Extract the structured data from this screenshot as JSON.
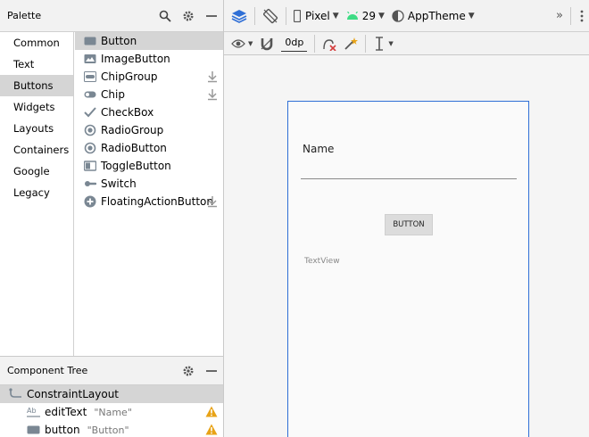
{
  "palette": {
    "title": "Palette",
    "categories": [
      "Common",
      "Text",
      "Buttons",
      "Widgets",
      "Layouts",
      "Containers",
      "Google",
      "Legacy"
    ],
    "selected_category": "Buttons",
    "widgets": [
      {
        "label": "Button",
        "icon": "button-icon",
        "download": false
      },
      {
        "label": "ImageButton",
        "icon": "image-button-icon",
        "download": false
      },
      {
        "label": "ChipGroup",
        "icon": "chip-group-icon",
        "download": true
      },
      {
        "label": "Chip",
        "icon": "chip-icon",
        "download": true
      },
      {
        "label": "CheckBox",
        "icon": "checkbox-icon",
        "download": false
      },
      {
        "label": "RadioGroup",
        "icon": "radio-group-icon",
        "download": false
      },
      {
        "label": "RadioButton",
        "icon": "radio-button-icon",
        "download": false
      },
      {
        "label": "ToggleButton",
        "icon": "toggle-button-icon",
        "download": false
      },
      {
        "label": "Switch",
        "icon": "switch-icon",
        "download": false
      },
      {
        "label": "FloatingActionButton",
        "icon": "fab-icon",
        "download": true
      }
    ]
  },
  "component_tree": {
    "title": "Component Tree",
    "root": "ConstraintLayout",
    "children": [
      {
        "id": "editText",
        "hint": "\"Name\"",
        "icon": "text-field-icon",
        "warning": true
      },
      {
        "id": "button",
        "hint": "\"Button\"",
        "icon": "button-icon",
        "warning": true
      }
    ]
  },
  "toolbar": {
    "device": "Pixel",
    "api_level": "29",
    "theme": "AppTheme",
    "default_margin": "0dp",
    "overflow": "»"
  },
  "canvas": {
    "name_label": "Name",
    "button_label": "BUTTON",
    "textview_label": "TextView"
  },
  "colors": {
    "accent_blue": "#2f6fd6",
    "android_green": "#3ddc84",
    "warning_orange": "#e8a317"
  }
}
